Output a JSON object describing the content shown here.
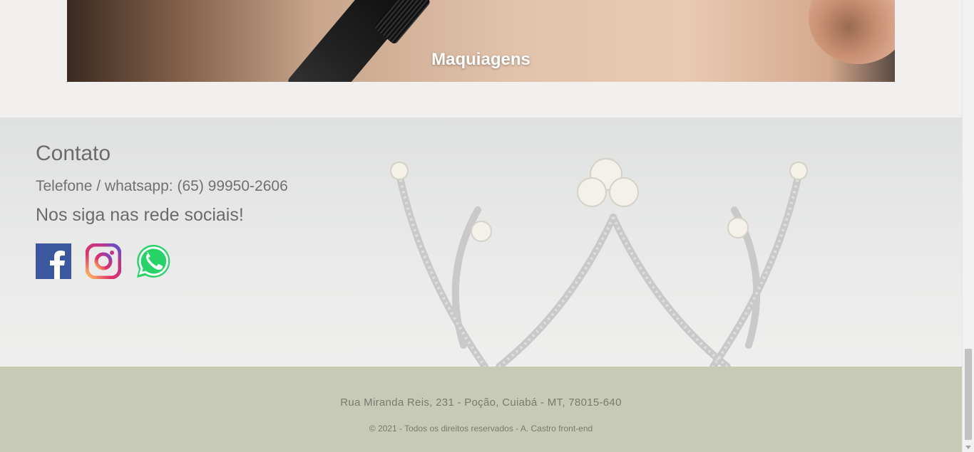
{
  "banner": {
    "title": "Maquiagens"
  },
  "contact": {
    "title": "Contato",
    "phone": "Telefone / whatsapp: (65) 99950-2606",
    "social_text": "Nos siga nas rede sociais!",
    "social_links": [
      {
        "name": "facebook",
        "icon": "facebook-icon",
        "color": "#3b579d"
      },
      {
        "name": "instagram",
        "icon": "instagram-icon",
        "color": "#c13584"
      },
      {
        "name": "whatsapp",
        "icon": "whatsapp-icon",
        "color": "#25d366"
      }
    ]
  },
  "footer": {
    "address": "Rua Miranda Reis, 231 - Poção, Cuiabá - MT, 78015-640",
    "copyright": "© 2021 - Todos os direitos reservados - A. Castro front-end",
    "background_color": "#c7cab4"
  }
}
